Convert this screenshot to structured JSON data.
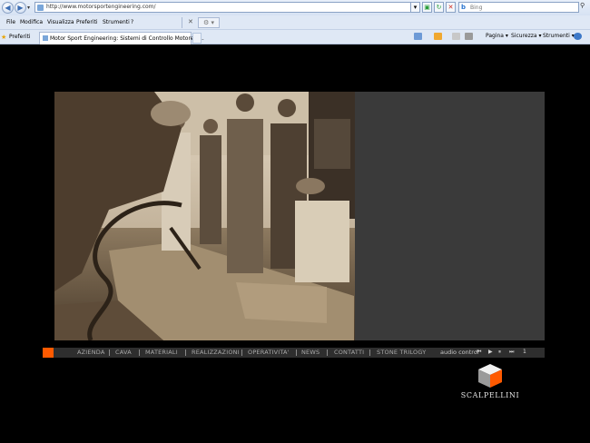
{
  "browser": {
    "url": "http://www.motorsportengineering.com/",
    "search_placeholder": "Bing",
    "menu": [
      "File",
      "Modifica",
      "Visualizza",
      "Preferiti",
      "Strumenti",
      "?"
    ],
    "favorites_label": "Preferiti",
    "tab_title": "Motor Sport Engineering: Sistemi di Controllo Motore e...",
    "toolbar": {
      "page_label": "Pagina ▾",
      "security_label": "Sicurezza ▾",
      "tools_label": "Strumenti ▾"
    }
  },
  "site": {
    "nav": [
      "AZIENDA",
      "CAVA",
      "MATERIALI",
      "REALIZZAZIONI",
      "OPERATIVITA'",
      "NEWS",
      "CONTATTI",
      "STONE TRILOGY"
    ],
    "audio": {
      "label": "audio control",
      "buttons": [
        "⏮",
        "▶",
        "⏸",
        "⏭"
      ],
      "track": "1"
    },
    "logo_text": "SCALPELLINI",
    "accent_color": "#ff5a00"
  }
}
